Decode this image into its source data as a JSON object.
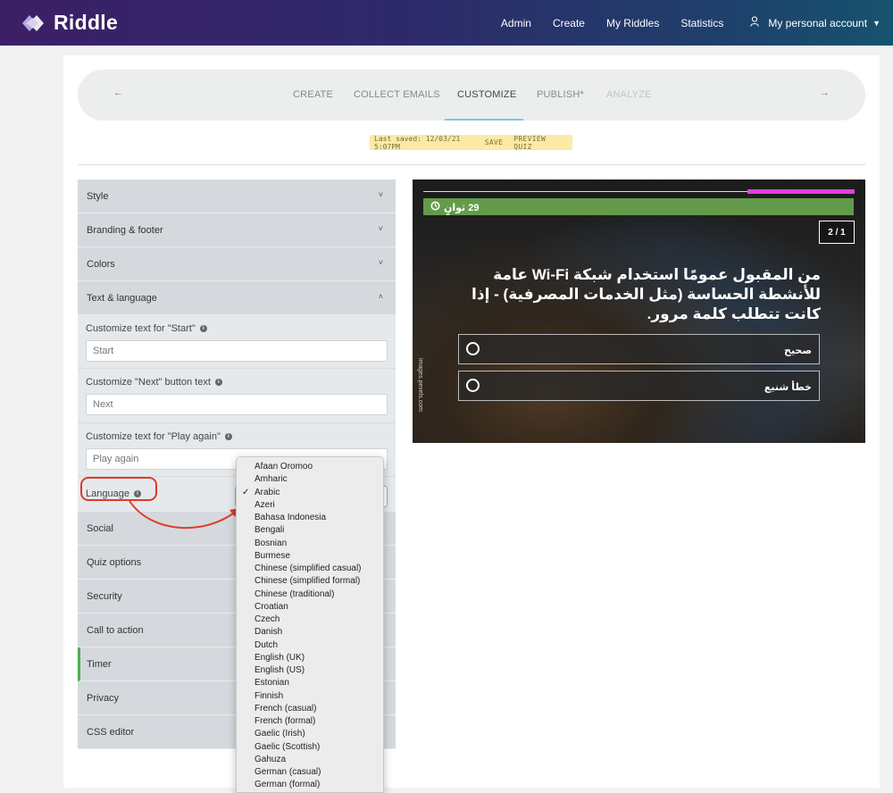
{
  "app": {
    "name": "Riddle"
  },
  "topnav": {
    "links": [
      "Admin",
      "Create",
      "My Riddles",
      "Statistics"
    ],
    "account": "My personal account"
  },
  "stepper": {
    "steps": [
      "CREATE",
      "COLLECT EMAILS",
      "CUSTOMIZE",
      "PUBLISH*",
      "ANALYZE"
    ],
    "active": "CUSTOMIZE"
  },
  "savebar": {
    "last_saved": "Last saved: 12/03/21 5:07PM",
    "save": "SAVE",
    "preview": "PREVIEW QUIZ"
  },
  "sections": {
    "style": "Style",
    "branding": "Branding & footer",
    "colors": "Colors",
    "text_language": "Text & language",
    "social": "Social",
    "quiz_options": "Quiz options",
    "security": "Security",
    "call_to_action": "Call to action",
    "timer": "Timer",
    "privacy": "Privacy",
    "css_editor": "CSS editor"
  },
  "text_settings": {
    "start_label": "Customize text for \"Start\"",
    "start_value": "Start",
    "next_label": "Customize \"Next\" button text",
    "next_value": "Next",
    "play_again_label": "Customize text for \"Play again\"",
    "play_again_value": "Play again",
    "language_label": "Language"
  },
  "preview": {
    "timer": "29 ثوانٍ",
    "counter": "2 / 1",
    "question": "من المقبول عمومًا استخدام شبكة Wi-Fi عامة للأنشطة الحساسة (مثل الخدمات المصرفية) - إذا كانت تتطلب كلمة مرور.",
    "answers": [
      "صحيح",
      "خطأ شنيع"
    ],
    "credit": "images.pexels.com"
  },
  "languages": {
    "selected": "Arabic",
    "options": [
      "Afaan Oromoo",
      "Amharic",
      "Arabic",
      "Azeri",
      "Bahasa Indonesia",
      "Bengali",
      "Bosnian",
      "Burmese",
      "Chinese (simplified casual)",
      "Chinese (simplified formal)",
      "Chinese (traditional)",
      "Croatian",
      "Czech",
      "Danish",
      "Dutch",
      "English (UK)",
      "English (US)",
      "Estonian",
      "Finnish",
      "French (casual)",
      "French (formal)",
      "Gaelic (Irish)",
      "Gaelic (Scottish)",
      "Gahuza",
      "German (casual)",
      "German (formal)"
    ]
  },
  "colors": {
    "accent_timer": "#6aa84f",
    "progress_pink": "#e040e0",
    "annotation_red": "#e03a2a"
  }
}
